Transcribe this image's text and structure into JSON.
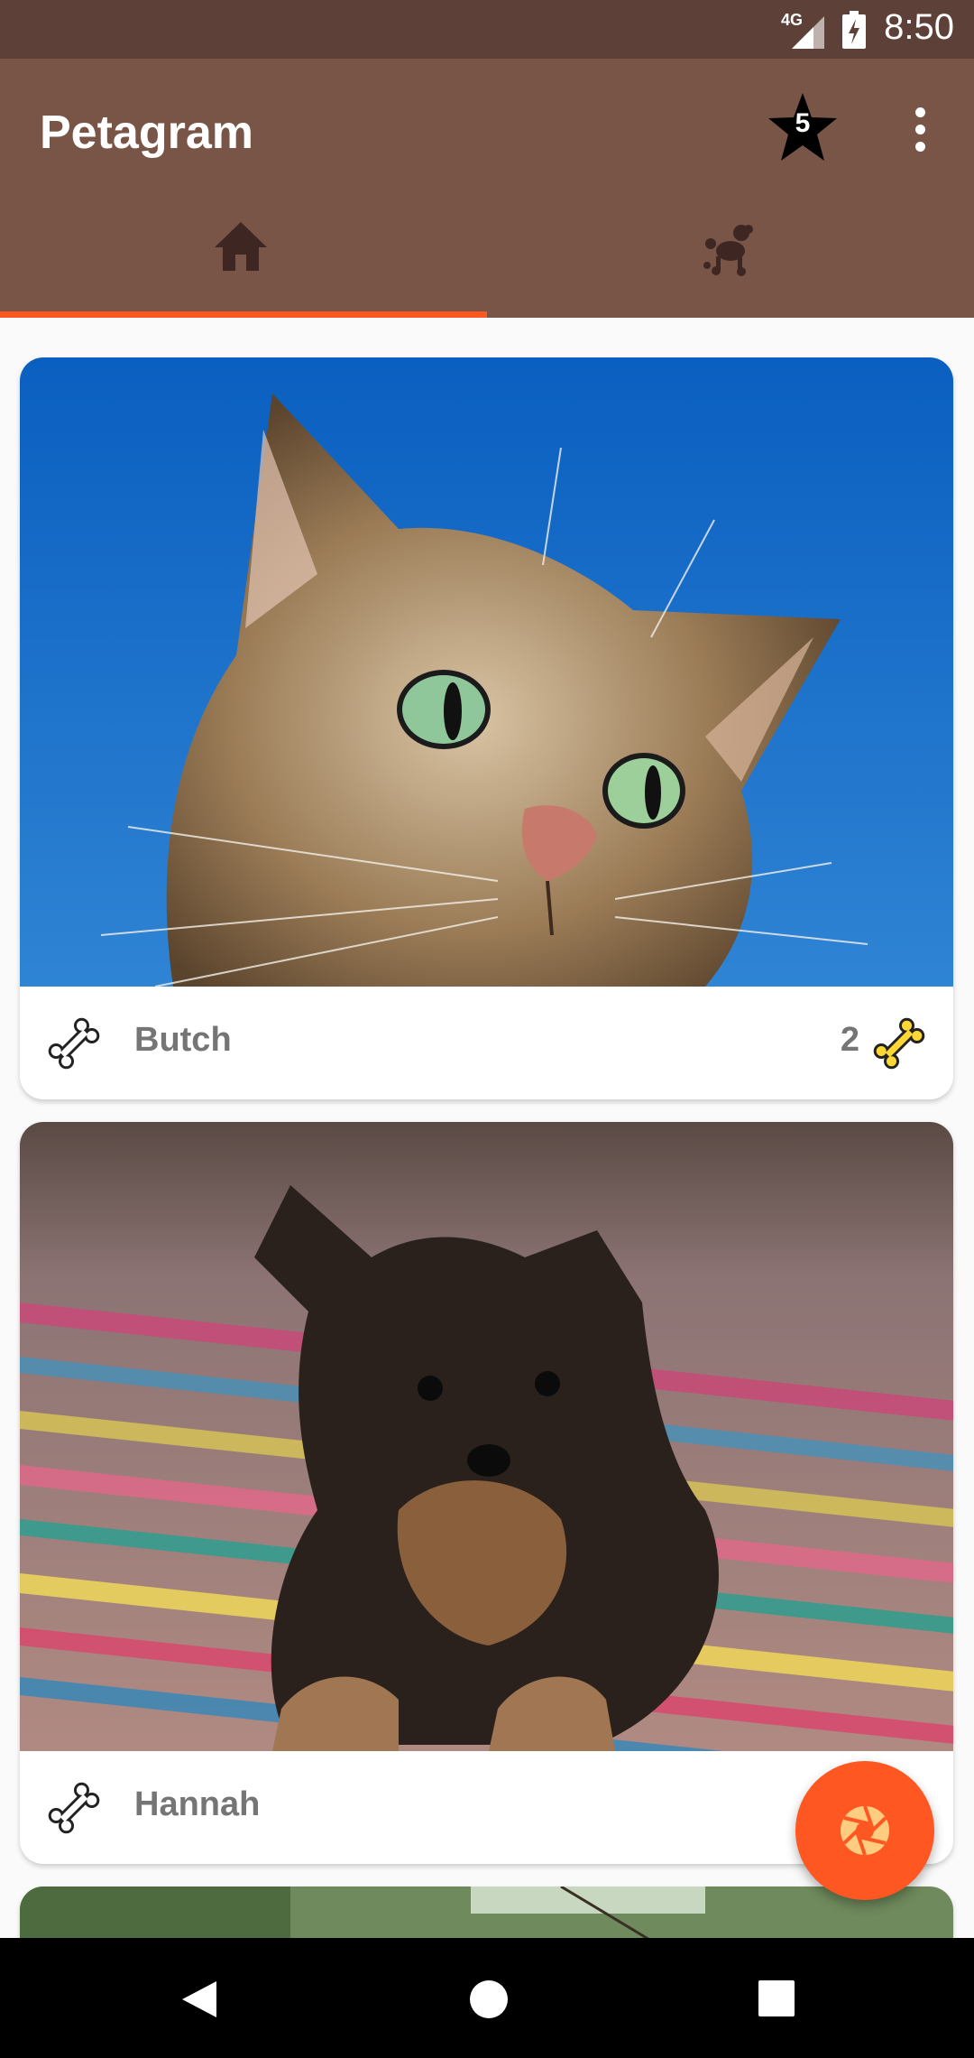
{
  "status_bar": {
    "time": "8:50",
    "network": "4G",
    "icons": [
      "signal-icon",
      "battery-charging-icon"
    ]
  },
  "app_bar": {
    "title": "Petagram",
    "favorites_count": "5",
    "favorites_icon": "star-icon",
    "overflow_icon": "more-vert-icon"
  },
  "tabs": [
    {
      "icon": "home-icon",
      "selected": true
    },
    {
      "icon": "poodle-icon",
      "selected": false
    }
  ],
  "cards": [
    {
      "name": "Butch",
      "rating": "2",
      "photo": "cat-photo",
      "like_icon": "bone-outline-icon",
      "rating_icon": "bone-yellow-icon"
    },
    {
      "name": "Hannah",
      "rating": "",
      "photo": "puppy-photo",
      "like_icon": "bone-outline-icon"
    }
  ],
  "fab": {
    "icon": "camera-shutter-icon"
  },
  "nav_bar": {
    "icons": [
      "back-icon",
      "home-circle-icon",
      "recents-icon"
    ]
  },
  "colors": {
    "status_bar": "#5d4037",
    "app_bar": "#795548",
    "accent": "#ff5722",
    "bone_yellow": "#fdd835"
  }
}
